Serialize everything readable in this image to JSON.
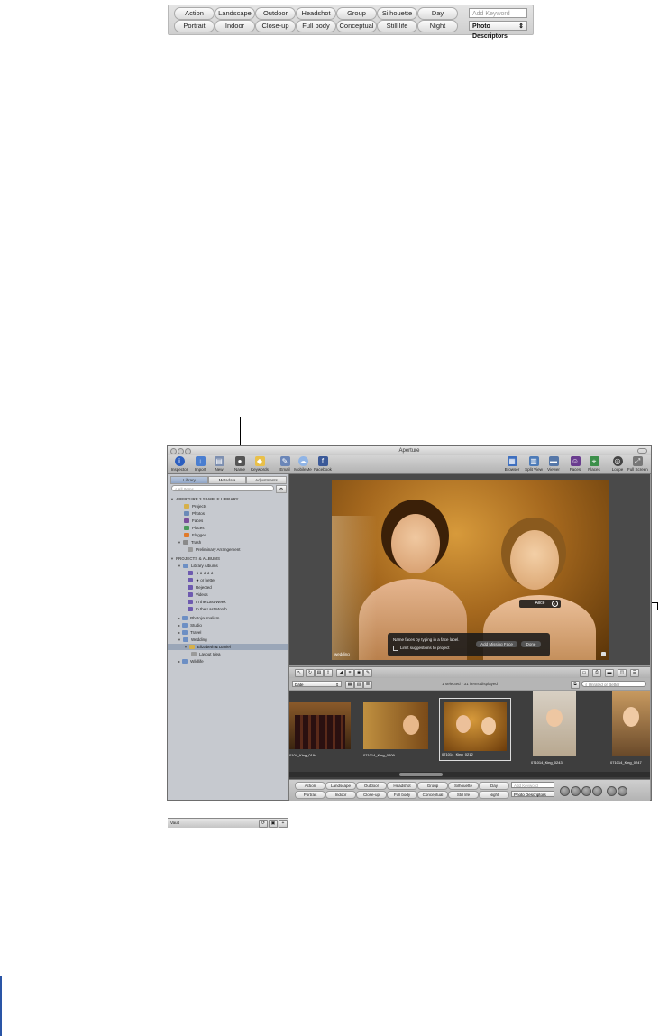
{
  "keyword_bar": {
    "row1": [
      "Action",
      "Landscape",
      "Outdoor",
      "Headshot",
      "Group",
      "Silhouette",
      "Day"
    ],
    "row2": [
      "Portrait",
      "Indoor",
      "Close-up",
      "Full body",
      "Conceptual",
      "Still life",
      "Night"
    ],
    "add_keyword_placeholder": "Add Keyword",
    "preset": "Photo Descriptors"
  },
  "window": {
    "title": "Aperture",
    "toolbar_left": [
      "Inspector",
      "Import",
      "New",
      "Name",
      "Keywords",
      "Email",
      "MobileMe",
      "Facebook"
    ],
    "toolbar_right": [
      "Browser",
      "Split View",
      "Viewer",
      "Faces",
      "Places",
      "Loupe",
      "Full Screen"
    ]
  },
  "inspector": {
    "tabs": [
      "Library",
      "Metadata",
      "Adjustments"
    ],
    "search_placeholder": "All Items",
    "section1": "APERTURE 3 SAMPLE LIBRARY",
    "library_items": [
      "Projects",
      "Photos",
      "Faces",
      "Places",
      "Flagged",
      "Trash"
    ],
    "trash_child": "Preliminary Arrangement",
    "section2": "PROJECTS & ALBUMS",
    "library_albums": "Library Albums",
    "album_items": [
      "★★★★★",
      "★ or better",
      "Rejected",
      "Videos",
      "In the Last Week",
      "In the Last Month"
    ],
    "projects": [
      "Photojournalism",
      "Studio",
      "Travel",
      "Wedding"
    ],
    "selected_project": "Elizabeth & Daniel",
    "selected_child": "Layout Idea",
    "last_project": "Wildlife",
    "vault_label": "Vault"
  },
  "viewer": {
    "face_label": "Alice",
    "hud_text": "Name faces by typing in a face label.",
    "hud_checkbox": "Limit suggestions to project",
    "add_missing_face": "Add Missing Face",
    "done": "Done",
    "photo_tag": "wedding"
  },
  "browser": {
    "sort": "Date",
    "status": "1 selected - 31 items displayed",
    "filter_placeholder": "Unrated or Better",
    "thumbs": [
      "0104_King_0194",
      "071014_King_0209",
      "071014_King_0212",
      "071014_King_0243",
      "071014_King_0247"
    ]
  },
  "colors": {
    "accent_blue": "#3a66b8",
    "window_gray": "#9a9a9a",
    "selection": "#9aa6b8"
  }
}
